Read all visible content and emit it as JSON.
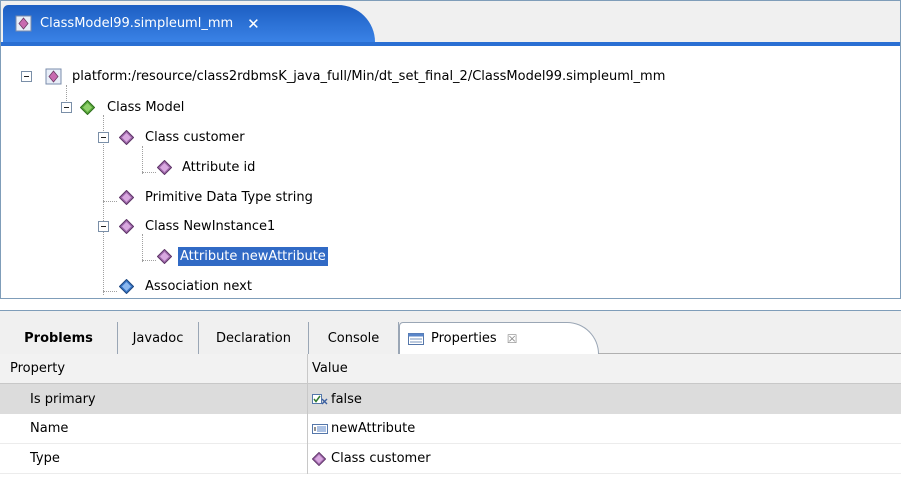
{
  "editor": {
    "tab_title": "ClassModel99.simpleuml_mm",
    "tab_close": "✕",
    "tree": [
      {
        "label": "platform:/resource/class2rdbmsK_java_full/Min/dt_set_final_2/ClassModel99.simpleuml_mm",
        "icon": "model-file-icon"
      },
      {
        "label": "Class Model",
        "icon": "green-diamond-icon"
      },
      {
        "label": "Class customer",
        "icon": "purple-diamond-icon"
      },
      {
        "label": "Attribute id",
        "icon": "purple-diamond-icon"
      },
      {
        "label": "Primitive Data Type string",
        "icon": "purple-diamond-icon"
      },
      {
        "label": "Class NewInstance1",
        "icon": "purple-diamond-icon"
      },
      {
        "label": "Attribute newAttribute",
        "icon": "purple-diamond-icon",
        "selected": true
      },
      {
        "label": "Association next",
        "icon": "blue-diamond-icon"
      }
    ]
  },
  "views": {
    "tabs": [
      {
        "label": "Problems"
      },
      {
        "label": "Javadoc"
      },
      {
        "label": "Declaration"
      },
      {
        "label": "Console"
      },
      {
        "label": "Properties",
        "close": "☒"
      }
    ],
    "properties": {
      "header": {
        "property": "Property",
        "value": "Value"
      },
      "rows": [
        {
          "property": "Is primary",
          "value": "false",
          "icon": "boolean-icon"
        },
        {
          "property": "Name",
          "value": "newAttribute",
          "icon": "text-field-icon"
        },
        {
          "property": "Type",
          "value": "Class customer",
          "icon": "purple-diamond-icon"
        }
      ]
    }
  },
  "colors": {
    "tab_blue": "#2a6fd3",
    "selection": "#316ac5",
    "class_diamond": "#a26cae",
    "model_diamond": "#5aa83c",
    "association_diamond": "#3a78c8"
  }
}
